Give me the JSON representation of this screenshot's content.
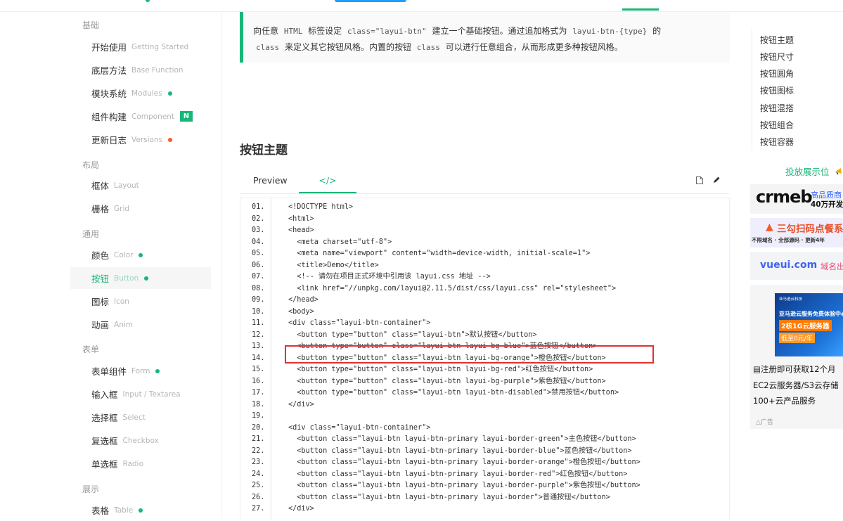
{
  "sidebar": {
    "groups": [
      {
        "title": "基础",
        "items": [
          {
            "label": "开始使用",
            "en": "Getting Started"
          },
          {
            "label": "底层方法",
            "en": "Base Function"
          },
          {
            "label": "模块系统",
            "en": "Modules",
            "mark": "green-dot"
          },
          {
            "label": "组件构建",
            "en": "Component",
            "mark": "badge",
            "badge": "N"
          },
          {
            "label": "更新日志",
            "en": "Versions",
            "mark": "orange-dot"
          }
        ]
      },
      {
        "title": "布局",
        "items": [
          {
            "label": "框体",
            "en": "Layout"
          },
          {
            "label": "栅格",
            "en": "Grid"
          }
        ]
      },
      {
        "title": "通用",
        "items": [
          {
            "label": "颜色",
            "en": "Color",
            "mark": "green-dot"
          },
          {
            "label": "按钮",
            "en": "Button",
            "mark": "green-dot",
            "active": true
          },
          {
            "label": "图标",
            "en": "Icon"
          },
          {
            "label": "动画",
            "en": "Anim"
          }
        ]
      },
      {
        "title": "表单",
        "items": [
          {
            "label": "表单组件",
            "en": "Form",
            "mark": "green-dot"
          },
          {
            "label": "输入框",
            "en": "Input / Textarea"
          },
          {
            "label": "选择框",
            "en": "Select"
          },
          {
            "label": "复选框",
            "en": "Checkbox"
          },
          {
            "label": "单选框",
            "en": "Radio"
          }
        ]
      },
      {
        "title": "展示",
        "items": [
          {
            "label": "表格",
            "en": "Table",
            "mark": "green-dot"
          }
        ]
      }
    ]
  },
  "intro": {
    "p1": "向任意",
    "c1": "HTML",
    "p2": "标签设定",
    "c2": "class=\"layui-btn\"",
    "p3": "建立一个基础按钮。通过追加格式为",
    "c3": "layui-btn-{type}",
    "p4": "的",
    "c4": "class",
    "p5": "来定义其它按钮风格。内置的按钮",
    "c5": "class",
    "p6": "可以进行任意组合，从而形成更多种按钮风格。"
  },
  "section_title": "按钮主题",
  "tabs": {
    "preview": "Preview",
    "code": "</>"
  },
  "code_lines": [
    {
      "n": "01.",
      "t": "<!DOCTYPE html>"
    },
    {
      "n": "02.",
      "t": "<html>"
    },
    {
      "n": "03.",
      "t": "<head>"
    },
    {
      "n": "04.",
      "t": "  <meta charset=\"utf-8\">"
    },
    {
      "n": "05.",
      "t": "  <meta name=\"viewport\" content=\"width=device-width, initial-scale=1\">"
    },
    {
      "n": "06.",
      "t": "  <title>Demo</title>"
    },
    {
      "n": "07.",
      "t": "  <!-- 请勿在项目正式环境中引用该 layui.css 地址 -->"
    },
    {
      "n": "08.",
      "t": "  <link href=\"//unpkg.com/layui@2.11.5/dist/css/layui.css\" rel=\"stylesheet\">"
    },
    {
      "n": "09.",
      "t": "</head>"
    },
    {
      "n": "10.",
      "t": "<body>"
    },
    {
      "n": "11.",
      "t": "<div class=\"layui-btn-container\">"
    },
    {
      "n": "12.",
      "t": "  <button type=\"button\" class=\"layui-btn\">默认按钮</button>"
    },
    {
      "n": "13.",
      "t": "  <button type=\"button\" class=\"layui-btn layui-bg-blue\">蓝色按钮</button>"
    },
    {
      "n": "14.",
      "t": "  <button type=\"button\" class=\"layui-btn layui-bg-orange\">橙色按钮</button>"
    },
    {
      "n": "15.",
      "t": "  <button type=\"button\" class=\"layui-btn layui-bg-red\">红色按钮</button>"
    },
    {
      "n": "16.",
      "t": "  <button type=\"button\" class=\"layui-btn layui-bg-purple\">紫色按钮</button>"
    },
    {
      "n": "17.",
      "t": "  <button type=\"button\" class=\"layui-btn layui-btn-disabled\">禁用按钮</button>"
    },
    {
      "n": "18.",
      "t": "</div>"
    },
    {
      "n": "19.",
      "t": ""
    },
    {
      "n": "20.",
      "t": "<div class=\"layui-btn-container\">"
    },
    {
      "n": "21.",
      "t": "  <button class=\"layui-btn layui-btn-primary layui-border-green\">主色按钮</button>"
    },
    {
      "n": "22.",
      "t": "  <button class=\"layui-btn layui-btn-primary layui-border-blue\">蓝色按钮</button>"
    },
    {
      "n": "23.",
      "t": "  <button class=\"layui-btn layui-btn-primary layui-border-orange\">橙色按钮</button>"
    },
    {
      "n": "24.",
      "t": "  <button class=\"layui-btn layui-btn-primary layui-border-red\">红色按钮</button>"
    },
    {
      "n": "25.",
      "t": "  <button class=\"layui-btn layui-btn-primary layui-border-purple\">紫色按钮</button>"
    },
    {
      "n": "26.",
      "t": "  <button class=\"layui-btn layui-btn-primary layui-border\">普通按钮</button>"
    },
    {
      "n": "27.",
      "t": "</div>"
    }
  ],
  "toc": [
    "按钮主题",
    "按钮尺寸",
    "按钮圆角",
    "按钮图标",
    "按钮混搭",
    "按钮组合",
    "按钮容器"
  ],
  "ads": {
    "title": "投放展示位",
    "crmeb_logo": "crmeb",
    "crmeb_line1": "高品质商",
    "crmeb_line2": "40万开发",
    "sanguo_line1": "三勾扫码点餐系",
    "sanguo_line2": "不限域名 · 全部源码 · 更新4年",
    "vueui_name": "vueui.com",
    "vueui_tag": "域名出",
    "aws_brand": "亚马逊云科技",
    "aws_line1": "亚马逊云服务免费体验中心",
    "aws_line2": "2核1G云服务器",
    "aws_line3": "低至0元/年",
    "aws_text1": "注册即可获取12个月",
    "aws_text2": "EC2云服务器/S3云存储",
    "aws_text3": "100+云产品服务",
    "ad_label": "广告"
  },
  "colors": {
    "accent": "#16b777",
    "highlight_box": "#e03131",
    "orange_dot": "#ff5722",
    "top_blue": "#1e9fff"
  }
}
